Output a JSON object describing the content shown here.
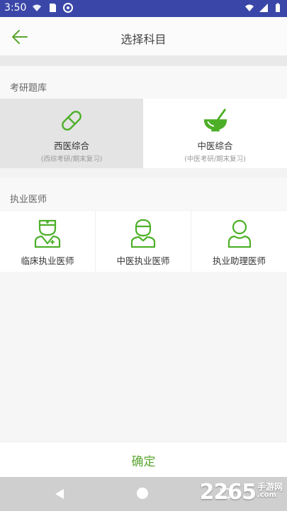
{
  "status_bar": {
    "time": "3:50"
  },
  "header": {
    "title": "选择科目"
  },
  "sections": [
    {
      "title": "考研题库",
      "items": [
        {
          "label": "西医综合",
          "sub": "(西综考研/期末复习)",
          "selected": true,
          "icon": "pill-icon"
        },
        {
          "label": "中医综合",
          "sub": "(中医考研/期末复习)",
          "selected": false,
          "icon": "mortar-pestle-icon"
        }
      ]
    },
    {
      "title": "执业医师",
      "items": [
        {
          "label": "临床执业医师",
          "icon": "doctor-nurse-icon"
        },
        {
          "label": "中医执业医师",
          "icon": "doctor-cap-icon"
        },
        {
          "label": "执业助理医师",
          "icon": "person-icon"
        }
      ]
    }
  ],
  "footer": {
    "confirm_label": "确定"
  },
  "colors": {
    "accent": "#5aa631",
    "status_bar": "#3a47a8"
  },
  "watermark": {
    "number": "2265",
    "cn": "手游网",
    "com": ".com"
  }
}
